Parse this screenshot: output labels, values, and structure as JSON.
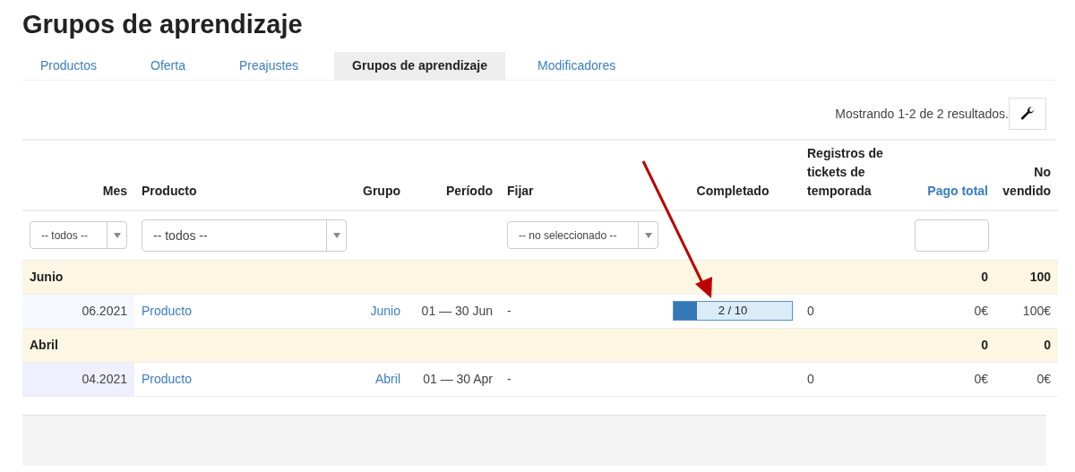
{
  "page": {
    "title": "Grupos de aprendizaje"
  },
  "tabs": [
    {
      "label": "Productos",
      "selected": false
    },
    {
      "label": "Oferta",
      "selected": false
    },
    {
      "label": "Preajustes",
      "selected": false
    },
    {
      "label": "Grupos de aprendizaje",
      "selected": true
    },
    {
      "label": "Modificadores",
      "selected": false
    }
  ],
  "toolbar": {
    "results": "Mostrando 1-2 de 2 resultados."
  },
  "table": {
    "columns": [
      {
        "label": "Mes",
        "kind": "plain"
      },
      {
        "label": "Producto",
        "kind": "plain"
      },
      {
        "label": "Grupo",
        "kind": "plain"
      },
      {
        "label": "Período",
        "kind": "plain"
      },
      {
        "label": "Fijar",
        "kind": "plain"
      },
      {
        "label": "Completado",
        "kind": "plain"
      },
      {
        "label": "Registros de tickets de temporada",
        "kind": "plain"
      },
      {
        "label": "Pago total",
        "kind": "link"
      },
      {
        "label": "No vendido",
        "kind": "plain"
      }
    ],
    "filters": [
      {
        "kind": "select",
        "value": "-- todos --"
      },
      {
        "kind": "select",
        "value": "-- todos --"
      },
      {
        "kind": "none"
      },
      {
        "kind": "none"
      },
      {
        "kind": "select",
        "value": "-- no seleccionado --"
      },
      {
        "kind": "none"
      },
      {
        "kind": "none"
      },
      {
        "kind": "input"
      },
      {
        "kind": "none"
      }
    ],
    "groups": [
      {
        "label": "Junio",
        "pago_total": "0",
        "no_vendido": "100",
        "rows": [
          {
            "mes": "06.2021",
            "color": "#f5f9ff",
            "producto": "Producto",
            "grupo": "Junio",
            "periodo": "01 — 30 Jun",
            "fijar": "-",
            "completado": {
              "level": 0.2,
              "text": "2 / 10"
            },
            "registros": "0",
            "pago_total": "0€",
            "no_vendido": "100€"
          }
        ]
      },
      {
        "label": "Abril",
        "pago_total": "0",
        "no_vendido": "0",
        "rows": [
          {
            "mes": "04.2021",
            "color": "#eef0fd",
            "producto": "Producto",
            "grupo": "Abril",
            "periodo": "01 — 30 Apr",
            "fijar": "-",
            "registros": "0",
            "pago_total": "0€",
            "no_vendido": "0€"
          }
        ]
      }
    ]
  }
}
